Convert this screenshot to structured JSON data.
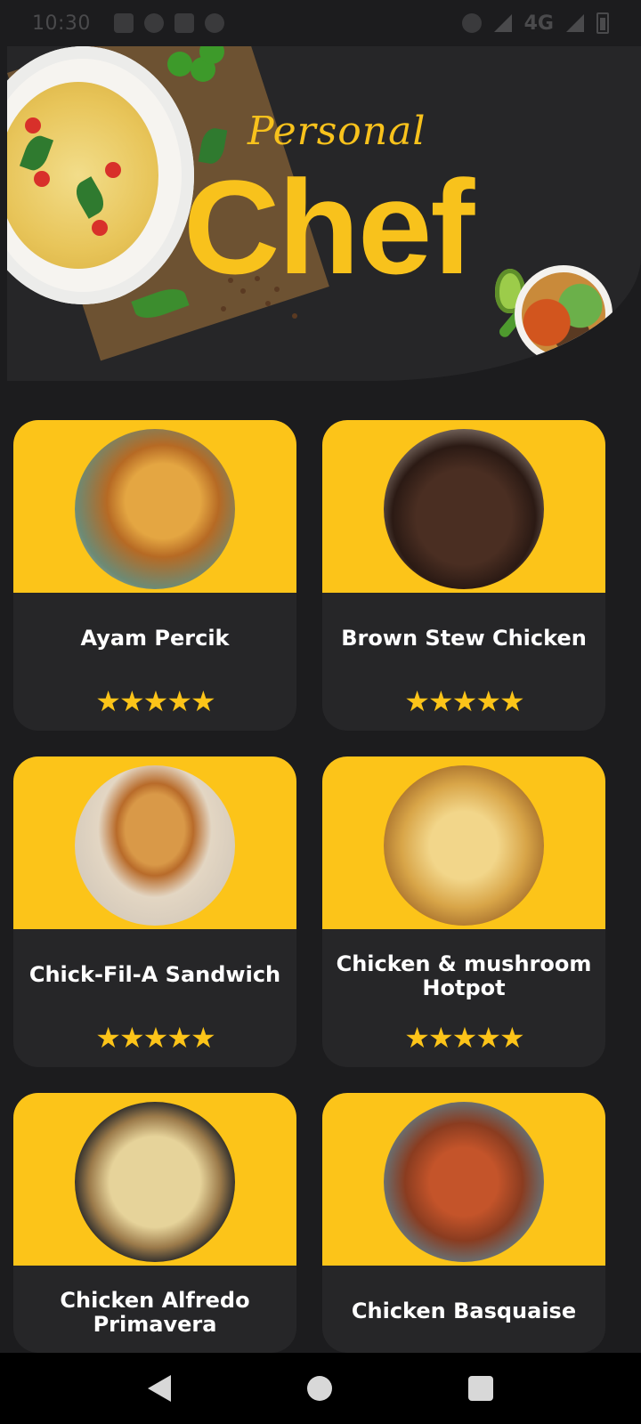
{
  "status_bar": {
    "time": "10:30",
    "network": "4G"
  },
  "header": {
    "script_title": "Personal",
    "main_title": "Chef"
  },
  "recipes": [
    {
      "name": "Ayam Percik",
      "stars": "★★★★★"
    },
    {
      "name": "Brown Stew Chicken",
      "stars": "★★★★★"
    },
    {
      "name": "Chick-Fil-A Sandwich",
      "stars": "★★★★★"
    },
    {
      "name": "Chicken & mushroom Hotpot",
      "stars": "★★★★★"
    },
    {
      "name": "Chicken Alfredo Primavera",
      "stars": ""
    },
    {
      "name": "Chicken Basquaise",
      "stars": ""
    }
  ],
  "colors": {
    "accent": "#fcc419",
    "background": "#1c1c1e",
    "card": "#262628"
  },
  "nav": {
    "back_icon": "back-triangle-icon",
    "home_icon": "home-circle-icon",
    "recent_icon": "recent-square-icon"
  }
}
